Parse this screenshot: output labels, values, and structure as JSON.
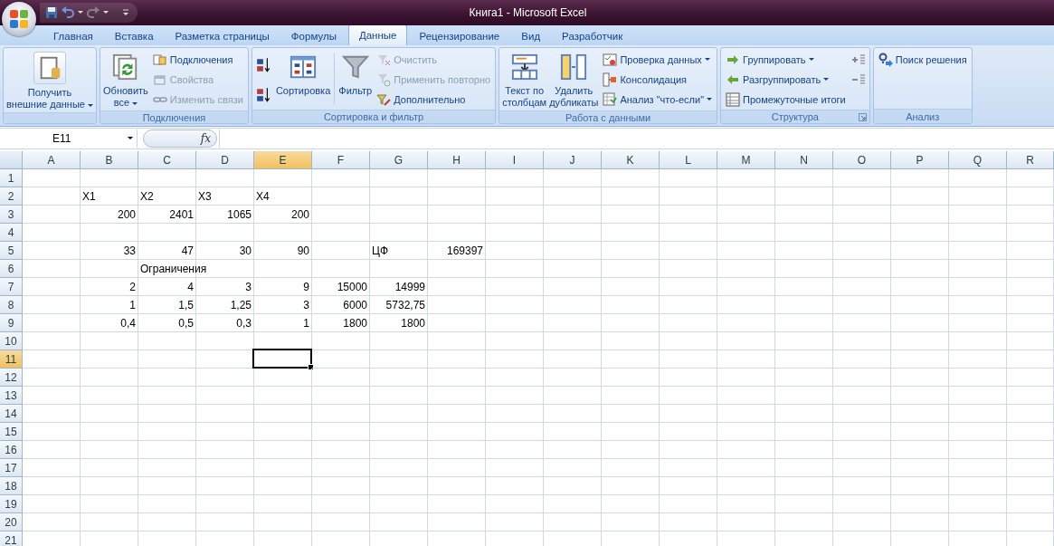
{
  "window": {
    "title": "Книга1 - Microsoft Excel"
  },
  "tabs": [
    {
      "label": "Главная",
      "selected": false
    },
    {
      "label": "Вставка",
      "selected": false
    },
    {
      "label": "Разметка страницы",
      "selected": false
    },
    {
      "label": "Формулы",
      "selected": false
    },
    {
      "label": "Данные",
      "selected": true
    },
    {
      "label": "Рецензирование",
      "selected": false
    },
    {
      "label": "Вид",
      "selected": false
    },
    {
      "label": "Разработчик",
      "selected": false
    }
  ],
  "ribbon": {
    "groups": [
      {
        "columns": [
          {
            "kind": "large",
            "items": [
              {
                "label": "Получить\nвнешние данные",
                "dropdown": true,
                "disabled": false
              }
            ]
          }
        ]
      },
      {
        "label": "Подключения",
        "columns": [
          {
            "kind": "large",
            "items": [
              {
                "label": "Обновить\nвсе",
                "dropdown": true,
                "disabled": false
              }
            ]
          },
          {
            "kind": "stack",
            "items": [
              {
                "label": "Подключения",
                "dropdown": false,
                "disabled": false
              },
              {
                "label": "Свойства",
                "dropdown": false,
                "disabled": true
              },
              {
                "label": "Изменить связи",
                "dropdown": false,
                "disabled": true
              }
            ]
          }
        ]
      },
      {
        "label": "Сортировка и фильтр",
        "columns": [
          {
            "kind": "icons",
            "items": [
              {
                "dropdown": false,
                "disabled": false
              },
              {
                "dropdown": false,
                "disabled": false
              }
            ]
          },
          {
            "kind": "large",
            "items": [
              {
                "label": "Сортировка",
                "dropdown": false,
                "disabled": false
              }
            ]
          },
          {
            "kind": "separator"
          },
          {
            "kind": "large",
            "items": [
              {
                "label": "Фильтр",
                "dropdown": false,
                "disabled": false
              }
            ]
          },
          {
            "kind": "stack",
            "items": [
              {
                "label": "Очистить",
                "dropdown": false,
                "disabled": true
              },
              {
                "label": "Применить повторно",
                "dropdown": false,
                "disabled": true
              },
              {
                "label": "Дополнительно",
                "dropdown": false,
                "disabled": false
              }
            ]
          }
        ]
      },
      {
        "label": "Работа с данными",
        "columns": [
          {
            "kind": "large",
            "items": [
              {
                "label": "Текст по\nстолбцам",
                "dropdown": false,
                "disabled": false
              }
            ]
          },
          {
            "kind": "large",
            "items": [
              {
                "label": "Удалить\nдубликаты",
                "dropdown": false,
                "disabled": false
              }
            ]
          },
          {
            "kind": "stack",
            "items": [
              {
                "label": "Проверка данных",
                "dropdown": true,
                "disabled": false
              },
              {
                "label": "Консолидация",
                "dropdown": false,
                "disabled": false
              },
              {
                "label": "Анализ \"что-если\"",
                "dropdown": true,
                "disabled": false
              }
            ]
          }
        ]
      },
      {
        "label": "Структура",
        "launcher": true,
        "columns": [
          {
            "kind": "stack",
            "items": [
              {
                "label": "Группировать",
                "dropdown": true,
                "disabled": false
              },
              {
                "label": "Разгруппировать",
                "dropdown": true,
                "disabled": false
              },
              {
                "label": "Промежуточные итоги",
                "dropdown": false,
                "disabled": false
              }
            ]
          },
          {
            "kind": "icons",
            "items": [
              {
                "dropdown": false,
                "disabled": false
              },
              {
                "dropdown": false,
                "disabled": false
              }
            ]
          }
        ]
      },
      {
        "label": "Анализ",
        "columns": [
          {
            "kind": "stack",
            "items": [
              {
                "label": "Поиск решения",
                "dropdown": false,
                "disabled": false
              }
            ]
          }
        ]
      }
    ]
  },
  "formula_bar": {
    "name_box": "E11",
    "function_label": "fx"
  },
  "sheet": {
    "columns": [
      {
        "label": "A",
        "selected": false
      },
      {
        "label": "B",
        "selected": false
      },
      {
        "label": "C",
        "selected": false
      },
      {
        "label": "D",
        "selected": false
      },
      {
        "label": "E",
        "selected": true
      },
      {
        "label": "F",
        "selected": false
      },
      {
        "label": "G",
        "selected": false
      },
      {
        "label": "H",
        "selected": false
      },
      {
        "label": "I",
        "selected": false
      },
      {
        "label": "J",
        "selected": false
      },
      {
        "label": "K",
        "selected": false
      },
      {
        "label": "L",
        "selected": false
      },
      {
        "label": "M",
        "selected": false
      },
      {
        "label": "N",
        "selected": false
      },
      {
        "label": "O",
        "selected": false
      },
      {
        "label": "P",
        "selected": false
      },
      {
        "label": "Q",
        "selected": false
      },
      {
        "label": "R",
        "selected": false
      }
    ],
    "rows": [
      {
        "label": "1",
        "selected": false
      },
      {
        "label": "2",
        "selected": false,
        "cells": [
          null,
          {
            "text": "X1",
            "kind": "text"
          },
          {
            "text": "X2",
            "kind": "text"
          },
          {
            "text": "X3",
            "kind": "text"
          },
          {
            "text": "X4",
            "kind": "text"
          }
        ]
      },
      {
        "label": "3",
        "selected": false,
        "cells": [
          null,
          {
            "text": "200",
            "kind": "number"
          },
          {
            "text": "2401",
            "kind": "number"
          },
          {
            "text": "1065",
            "kind": "number"
          },
          {
            "text": "200",
            "kind": "number"
          }
        ]
      },
      {
        "label": "4",
        "selected": false
      },
      {
        "label": "5",
        "selected": false,
        "cells": [
          null,
          {
            "text": "33",
            "kind": "number"
          },
          {
            "text": "47",
            "kind": "number"
          },
          {
            "text": "30",
            "kind": "number"
          },
          {
            "text": "90",
            "kind": "number"
          },
          null,
          {
            "text": "ЦФ",
            "kind": "text"
          },
          {
            "text": "169397",
            "kind": "number"
          }
        ]
      },
      {
        "label": "6",
        "selected": false,
        "cells": [
          null,
          null,
          {
            "text": "Ограничения",
            "kind": "text"
          }
        ]
      },
      {
        "label": "7",
        "selected": false,
        "cells": [
          null,
          {
            "text": "2",
            "kind": "number"
          },
          {
            "text": "4",
            "kind": "number"
          },
          {
            "text": "3",
            "kind": "number"
          },
          {
            "text": "9",
            "kind": "number"
          },
          {
            "text": "15000",
            "kind": "number"
          },
          {
            "text": "14999",
            "kind": "number"
          }
        ]
      },
      {
        "label": "8",
        "selected": false,
        "cells": [
          null,
          {
            "text": "1",
            "kind": "number"
          },
          {
            "text": "1,5",
            "kind": "number"
          },
          {
            "text": "1,25",
            "kind": "number"
          },
          {
            "text": "3",
            "kind": "number"
          },
          {
            "text": "6000",
            "kind": "number"
          },
          {
            "text": "5732,75",
            "kind": "number"
          }
        ]
      },
      {
        "label": "9",
        "selected": false,
        "cells": [
          null,
          {
            "text": "0,4",
            "kind": "number"
          },
          {
            "text": "0,5",
            "kind": "number"
          },
          {
            "text": "0,3",
            "kind": "number"
          },
          {
            "text": "1",
            "kind": "number"
          },
          {
            "text": "1800",
            "kind": "number"
          },
          {
            "text": "1800",
            "kind": "number"
          }
        ]
      },
      {
        "label": "10",
        "selected": false
      },
      {
        "label": "11",
        "selected": true
      },
      {
        "label": "12",
        "selected": false
      },
      {
        "label": "13",
        "selected": false
      },
      {
        "label": "14",
        "selected": false
      },
      {
        "label": "15",
        "selected": false
      },
      {
        "label": "16",
        "selected": false
      },
      {
        "label": "17",
        "selected": false
      },
      {
        "label": "18",
        "selected": false
      },
      {
        "label": "19",
        "selected": false
      },
      {
        "label": "20",
        "selected": false
      },
      {
        "label": "21",
        "selected": false
      }
    ]
  }
}
